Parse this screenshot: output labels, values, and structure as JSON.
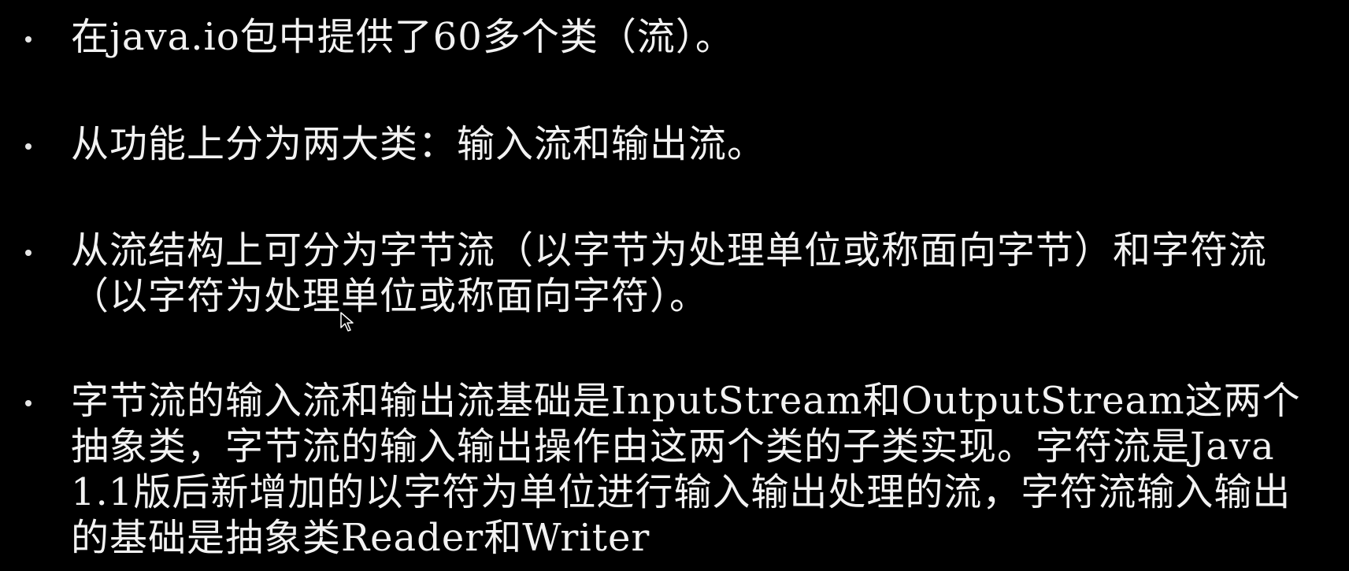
{
  "slide": {
    "bullets": [
      {
        "text": "在java.io包中提供了60多个类（流）。"
      },
      {
        "text": "从功能上分为两大类：输入流和输出流。"
      },
      {
        "text": "从流结构上可分为字节流（以字节为处理单位或称面向字节）和字符流（以字符为处理单位或称面向字符）。"
      },
      {
        "text": "字节流的输入流和输出流基础是InputStream和OutputStream这两个抽象类，字节流的输入输出操作由这两个类的子类实现。字符流是Java 1.1版后新增加的以字符为单位进行输入输出处理的流，字符流输入输出的基础是抽象类Reader和Writer"
      }
    ]
  }
}
